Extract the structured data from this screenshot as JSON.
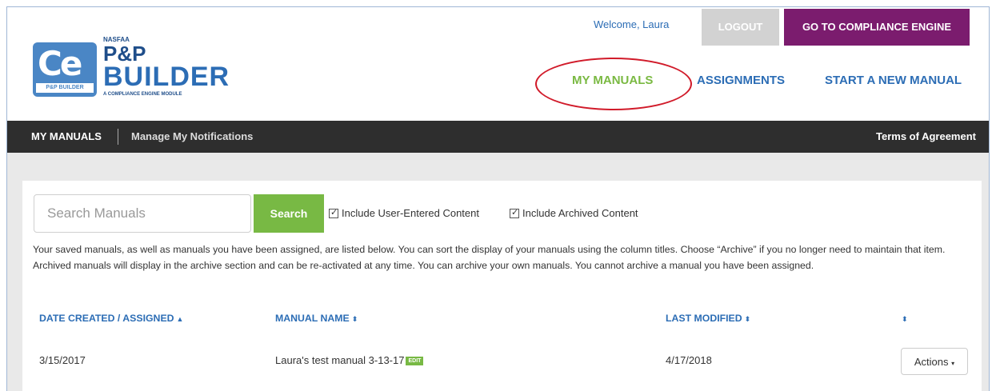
{
  "header": {
    "logo": {
      "nasfaa": "NASFAA",
      "title_line1": "P&P",
      "title_line2": "BUILDER",
      "tagline": "A COMPLIANCE ENGINE MODULE",
      "badge_text": "Ce",
      "badge_sub": "P&P BUILDER"
    },
    "welcome": "Welcome, Laura",
    "logout_label": "LOGOUT",
    "compliance_label": "GO TO COMPLIANCE ENGINE",
    "nav": {
      "my_manuals": "MY MANUALS",
      "assignments": "ASSIGNMENTS",
      "new_manual": "START A NEW MANUAL"
    }
  },
  "subnav": {
    "my_manuals": "MY MANUALS",
    "notifications": "Manage My Notifications",
    "terms": "Terms of Agreement"
  },
  "search": {
    "placeholder": "Search Manuals",
    "button_label": "Search",
    "include_user_content": "Include User-Entered Content",
    "include_archived": "Include Archived Content"
  },
  "description": "Your saved manuals, as well as manuals you have been assigned, are listed below. You can sort the display of your manuals using the column titles. Choose “Archive” if you no longer need to maintain that item. Archived manuals will display in the archive section and can be re-activated at any time.  You can archive your own manuals. You cannot archive a manual you have been assigned.",
  "table": {
    "headers": {
      "date": "DATE CREATED / ASSIGNED",
      "name": "MANUAL NAME",
      "modified": "LAST MODIFIED"
    },
    "rows": [
      {
        "date": "3/15/2017",
        "name": "Laura's test manual 3-13-17",
        "edit_badge": "EDIT",
        "modified": "4/17/2018",
        "actions_label": "Actions"
      }
    ]
  },
  "colors": {
    "brand_blue": "#2c6db5",
    "green": "#78b944",
    "purple": "#7b1c6e",
    "dark_bar": "#2e2e2e",
    "highlight_circle": "#d11b2a"
  }
}
